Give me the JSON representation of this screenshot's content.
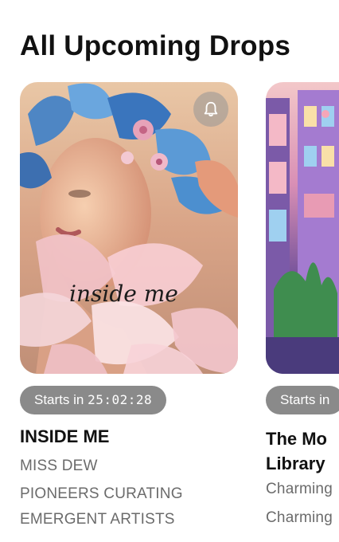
{
  "page": {
    "title": "All Upcoming Drops"
  },
  "drops": [
    {
      "artwork_text": "inside me",
      "countdown_prefix": "Starts in",
      "countdown_time": "25:02:28",
      "name": "INSIDE ME",
      "artist": "MISS DEW",
      "curator_line1": "PIONEERS CURATING",
      "curator_line2": "EMERGENT ARTISTS"
    },
    {
      "countdown_prefix": "Starts in",
      "name_line1": "The Mo",
      "name_line2": "Library",
      "artist": "Charming",
      "curator": "Charming"
    }
  ],
  "icons": {
    "reminder": "bell-icon"
  }
}
